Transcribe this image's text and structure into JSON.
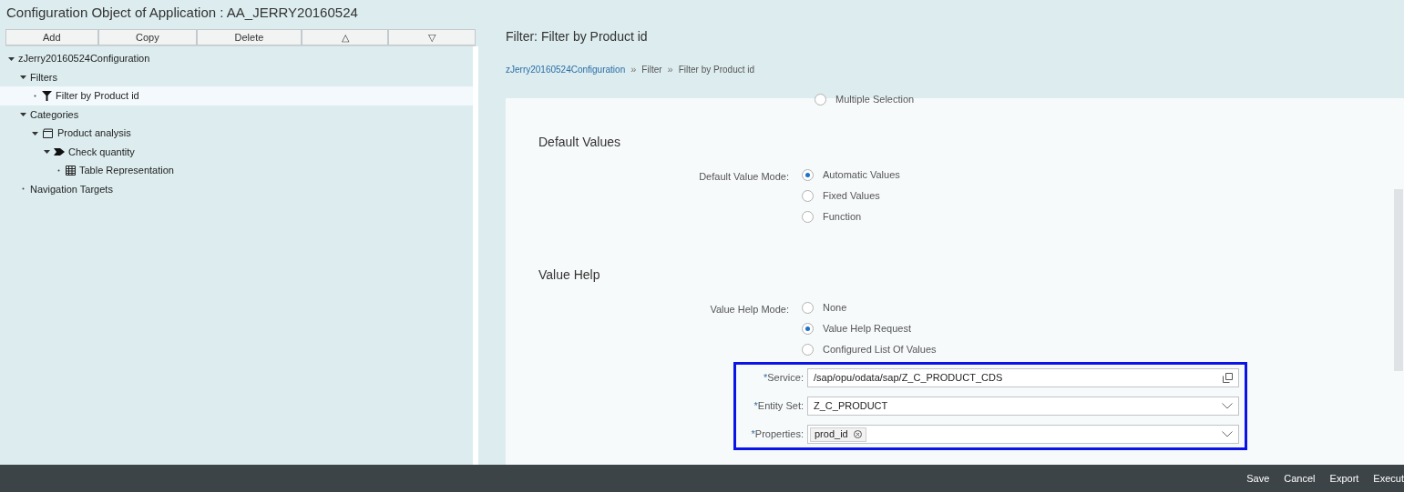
{
  "window": {
    "title": "Configuration Object of Application : AA_JERRY20160524"
  },
  "toolbar": [
    "Add",
    "Copy",
    "Delete",
    "△",
    "▽"
  ],
  "tree": [
    {
      "label": "zJerry20160524Configuration",
      "expanded": true,
      "selected": false,
      "children": [
        {
          "label": "Filters",
          "expanded": true,
          "selected": false,
          "children": [
            {
              "label": "Filter by Product id",
              "kind": "filter",
              "selected": true
            }
          ]
        },
        {
          "label": "Categories",
          "expanded": true,
          "selected": false,
          "children": [
            {
              "label": "Product analysis",
              "kind": "category",
              "expanded": true,
              "selected": false,
              "children": [
                {
                  "label": "Check quantity",
                  "kind": "step",
                  "expanded": true,
                  "selected": false,
                  "children": [
                    {
                      "label": "Table Representation",
                      "kind": "table",
                      "selected": false
                    }
                  ]
                }
              ]
            }
          ]
        },
        {
          "label": "Navigation Targets",
          "selected": false
        }
      ]
    }
  ],
  "detail": {
    "title": "Filter: Filter by Product id",
    "breadcrumb_separator": "»",
    "breadcrumb": [
      {
        "label": "zJerry20160524Configuration",
        "link": true
      },
      {
        "label": "Filter",
        "link": false
      },
      {
        "label": "Filter by Product id",
        "link": false
      }
    ],
    "top_option": {
      "label": "Multiple Selection",
      "selected": false
    },
    "sections": [
      {
        "title": "Default Values",
        "groups": [
          {
            "label": "Default Value Mode:",
            "options": [
              {
                "label": "Automatic Values",
                "selected": true
              },
              {
                "label": "Fixed Values",
                "selected": false
              },
              {
                "label": "Function",
                "selected": false
              }
            ]
          }
        ]
      },
      {
        "title": "Value Help",
        "groups": [
          {
            "label": "Value Help Mode:",
            "options": [
              {
                "label": "None",
                "selected": false
              },
              {
                "label": "Value Help Request",
                "selected": true
              },
              {
                "label": "Configured List Of Values",
                "selected": false
              }
            ]
          }
        ]
      }
    ],
    "fields": [
      {
        "label": "Service:",
        "required_mark": "*",
        "kind": "text",
        "value": "/sap/opu/odata/sap/Z_C_PRODUCT_CDS"
      },
      {
        "label": "Entity Set:",
        "required_mark": "*",
        "kind": "select",
        "value": "Z_C_PRODUCT"
      },
      {
        "label": "Properties:",
        "required_mark": "*",
        "kind": "tokens",
        "tokens": [
          "prod_id"
        ]
      }
    ]
  },
  "footer": [
    "Save",
    "Cancel",
    "Export",
    "Execut"
  ]
}
